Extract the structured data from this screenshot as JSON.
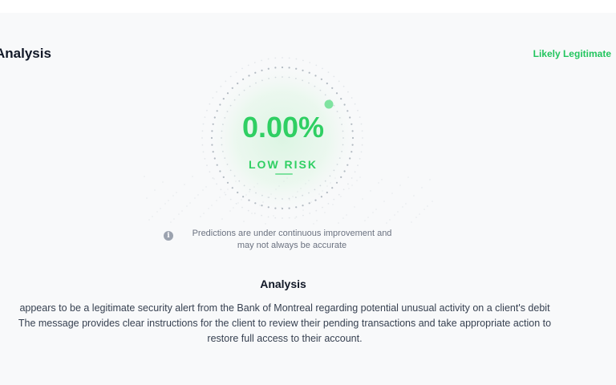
{
  "card": {
    "title": "Analysis",
    "verdict": "Likely Legitimate"
  },
  "gauge": {
    "risk_percent": "0.00%",
    "risk_level": "LOW RISK",
    "risk_value": 0.0,
    "accent_color": "#2fcf63"
  },
  "disclaimer": {
    "icon": "info-icon",
    "line1": "Predictions are under continuous improvement and",
    "line2": "may not always be accurate"
  },
  "analysis": {
    "heading": "Analysis",
    "line1": "appears to be a legitimate security alert from the Bank of Montreal regarding potential unusual activity on a client's debit",
    "line2": "The message provides clear instructions for the client to review their pending transactions and take appropriate action to",
    "line3": "restore full access to their account."
  }
}
